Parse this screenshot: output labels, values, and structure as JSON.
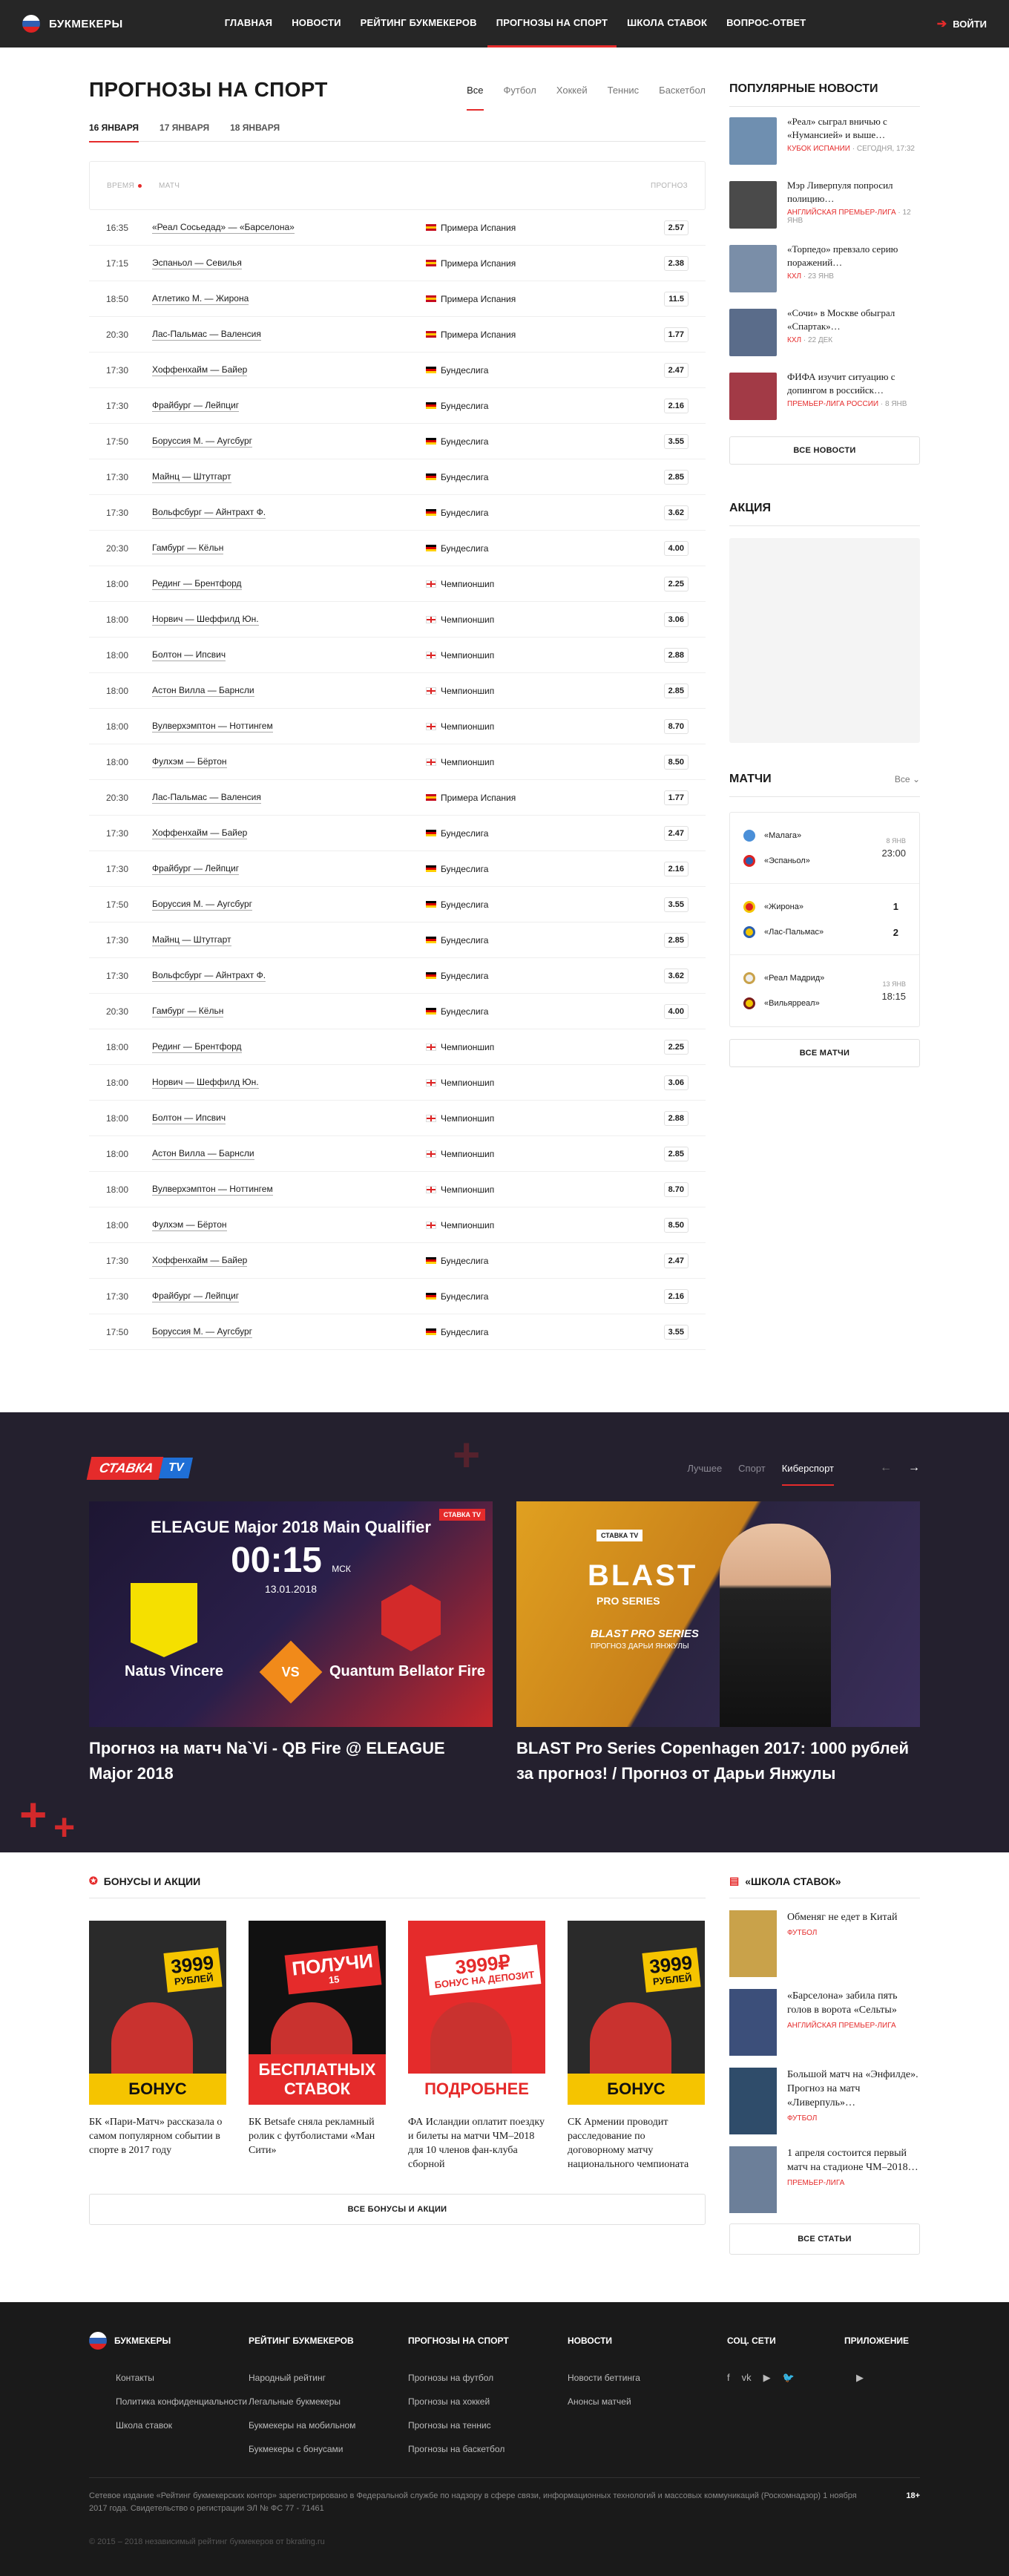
{
  "header": {
    "logo": "БУКМЕКЕРЫ",
    "nav": [
      "ГЛАВНАЯ",
      "НОВОСТИ",
      "РЕЙТИНГ БУКМЕКЕРОВ",
      "ПРОГНОЗЫ НА СПОРТ",
      "ШКОЛА СТАВОК",
      "ВОПРОС-ОТВЕТ"
    ],
    "login": "ВОЙТИ"
  },
  "page": {
    "title": "ПРОГНОЗЫ НА СПОРТ",
    "sport_tabs": [
      "Все",
      "Футбол",
      "Хоккей",
      "Теннис",
      "Баскетбол"
    ],
    "date_tabs": [
      "16 ЯНВАРЯ",
      "17 ЯНВАРЯ",
      "18 ЯНВАРЯ"
    ],
    "col_time": "ВРЕМЯ",
    "col_match": "МАТЧ",
    "col_forecast": "ПРОГНОЗ"
  },
  "matches": [
    {
      "time": "16:35",
      "match": "«Реал Сосьедад» — «Барселона»",
      "league": "Примера Испания",
      "flag": "es",
      "odd": "2.57"
    },
    {
      "time": "17:15",
      "match": "Эспаньол — Севилья",
      "league": "Примера Испания",
      "flag": "es",
      "odd": "2.38"
    },
    {
      "time": "18:50",
      "match": "Атлетико М. — Жирона",
      "league": "Примера Испания",
      "flag": "es",
      "odd": "11.5"
    },
    {
      "time": "20:30",
      "match": "Лас-Пальмас — Валенсия",
      "league": "Примера Испания",
      "flag": "es",
      "odd": "1.77"
    },
    {
      "time": "17:30",
      "match": "Хоффенхайм — Байер",
      "league": "Бундеслига",
      "flag": "de",
      "odd": "2.47"
    },
    {
      "time": "17:30",
      "match": "Фрайбург — Лейпциг",
      "league": "Бундеслига",
      "flag": "de",
      "odd": "2.16"
    },
    {
      "time": "17:50",
      "match": "Боруссия М. — Аугсбург",
      "league": "Бундеслига",
      "flag": "de",
      "odd": "3.55"
    },
    {
      "time": "17:30",
      "match": "Майнц — Штутгарт",
      "league": "Бундеслига",
      "flag": "de",
      "odd": "2.85"
    },
    {
      "time": "17:30",
      "match": "Вольфсбург — Айнтрахт Ф.",
      "league": "Бундеслига",
      "flag": "de",
      "odd": "3.62"
    },
    {
      "time": "20:30",
      "match": "Гамбург — Кёльн",
      "league": "Бундеслига",
      "flag": "de",
      "odd": "4.00"
    },
    {
      "time": "18:00",
      "match": "Рединг — Брентфорд",
      "league": "Чемпионшип",
      "flag": "en",
      "odd": "2.25"
    },
    {
      "time": "18:00",
      "match": "Норвич — Шеффилд Юн.",
      "league": "Чемпионшип",
      "flag": "en",
      "odd": "3.06"
    },
    {
      "time": "18:00",
      "match": "Болтон — Ипсвич",
      "league": "Чемпионшип",
      "flag": "en",
      "odd": "2.88"
    },
    {
      "time": "18:00",
      "match": "Астон Вилла — Барнсли",
      "league": "Чемпионшип",
      "flag": "en",
      "odd": "2.85"
    },
    {
      "time": "18:00",
      "match": "Вулверхэмптон — Ноттингем",
      "league": "Чемпионшип",
      "flag": "en",
      "odd": "8.70"
    },
    {
      "time": "18:00",
      "match": "Фулхэм — Бёртон",
      "league": "Чемпионшип",
      "flag": "en",
      "odd": "8.50"
    },
    {
      "time": "20:30",
      "match": "Лас-Пальмас — Валенсия",
      "league": "Примера Испания",
      "flag": "es",
      "odd": "1.77"
    },
    {
      "time": "17:30",
      "match": "Хоффенхайм — Байер",
      "league": "Бундеслига",
      "flag": "de",
      "odd": "2.47"
    },
    {
      "time": "17:30",
      "match": "Фрайбург — Лейпциг",
      "league": "Бундеслига",
      "flag": "de",
      "odd": "2.16"
    },
    {
      "time": "17:50",
      "match": "Боруссия М. — Аугсбург",
      "league": "Бундеслига",
      "flag": "de",
      "odd": "3.55"
    },
    {
      "time": "17:30",
      "match": "Майнц — Штутгарт",
      "league": "Бундеслига",
      "flag": "de",
      "odd": "2.85"
    },
    {
      "time": "17:30",
      "match": "Вольфсбург — Айнтрахт Ф.",
      "league": "Бундеслига",
      "flag": "de",
      "odd": "3.62"
    },
    {
      "time": "20:30",
      "match": "Гамбург — Кёльн",
      "league": "Бундеслига",
      "flag": "de",
      "odd": "4.00"
    },
    {
      "time": "18:00",
      "match": "Рединг — Брентфорд",
      "league": "Чемпионшип",
      "flag": "en",
      "odd": "2.25"
    },
    {
      "time": "18:00",
      "match": "Норвич — Шеффилд Юн.",
      "league": "Чемпионшип",
      "flag": "en",
      "odd": "3.06"
    },
    {
      "time": "18:00",
      "match": "Болтон — Ипсвич",
      "league": "Чемпионшип",
      "flag": "en",
      "odd": "2.88"
    },
    {
      "time": "18:00",
      "match": "Астон Вилла — Барнсли",
      "league": "Чемпионшип",
      "flag": "en",
      "odd": "2.85"
    },
    {
      "time": "18:00",
      "match": "Вулверхэмптон — Ноттингем",
      "league": "Чемпионшип",
      "flag": "en",
      "odd": "8.70"
    },
    {
      "time": "18:00",
      "match": "Фулхэм — Бёртон",
      "league": "Чемпионшип",
      "flag": "en",
      "odd": "8.50"
    },
    {
      "time": "17:30",
      "match": "Хоффенхайм — Байер",
      "league": "Бундеслига",
      "flag": "de",
      "odd": "2.47"
    },
    {
      "time": "17:30",
      "match": "Фрайбург — Лейпциг",
      "league": "Бундеслига",
      "flag": "de",
      "odd": "2.16"
    },
    {
      "time": "17:50",
      "match": "Боруссия М. — Аугсбург",
      "league": "Бундеслига",
      "flag": "de",
      "odd": "3.55"
    }
  ],
  "popular": {
    "title": "ПОПУЛЯРНЫЕ НОВОСТИ",
    "items": [
      {
        "title": "«Реал» сыграл вничью с «Нумансией» и выше…",
        "cat": "КУБОК ИСПАНИИ",
        "date": "СЕГОДНЯ, 17:32",
        "color": "#6f8fb0"
      },
      {
        "title": "Мэр Ливерпуля попросил полицию…",
        "cat": "АНГЛИЙСКАЯ ПРЕМЬЕР-ЛИГА",
        "date": "12 ЯНВ",
        "color": "#4a4a4a"
      },
      {
        "title": "«Торпедо» превзало серию поражений…",
        "cat": "КХЛ",
        "date": "23 ЯНВ",
        "color": "#7a8ea8"
      },
      {
        "title": "«Сочи» в Москве обыграл «Спартак»…",
        "cat": "КХЛ",
        "date": "22 ДЕК",
        "color": "#5a6c8a"
      },
      {
        "title": "ФИФА изучит ситуацию с допингом в российск…",
        "cat": "ПРЕМЬЕР-ЛИГА РОССИИ",
        "date": "8 ЯНВ",
        "color": "#a23a46"
      }
    ],
    "all": "ВСЕ НОВОСТИ"
  },
  "promo": {
    "title": "АКЦИЯ"
  },
  "side_matches": {
    "title": "МАТЧИ",
    "filter": "Все",
    "items": [
      {
        "home": "«Малага»",
        "away": "«Эспаньол»",
        "date": "8 ЯНВ",
        "time": "23:00"
      },
      {
        "home": "«Жирона»",
        "away": "«Лас-Пальмас»",
        "s1": "1",
        "s2": "2"
      },
      {
        "home": "«Реал Мадрид»",
        "away": "«Вильярреал»",
        "date": "13 ЯНВ",
        "time": "18:15"
      }
    ],
    "all": "ВСЕ МАТЧИ"
  },
  "tv": {
    "logo1": "СТАВКА",
    "logo2": "TV",
    "tabs": [
      "Лучшее",
      "Спорт",
      "Киберспорт"
    ],
    "arr_prev": "←",
    "arr_next": "→",
    "v1": {
      "event": "ELEAGUE Major 2018 Main Qualifier",
      "timer": "00:15",
      "tz": "МСК",
      "date": "13.01.2018",
      "t1": "Natus Vincere",
      "t2": "Quantum Bellator Fire",
      "vs": "VS",
      "tag": "СТАВКА TV",
      "caption": "Прогноз на матч Na`Vi - QB Fire @ ELEAGUE Major 2018"
    },
    "v2": {
      "tag": "СТАВКА TV",
      "brand": "BLAST",
      "sub": "PRO SERIES",
      "line1": "BLAST PRO SERIES",
      "line2": "ПРОГНОЗ ДАРЬИ ЯНЖУЛЫ",
      "caption": "BLAST Pro Series Copenhagen 2017: 1000 рублей за прогноз! / Прогноз от Дарьи Янжулы"
    }
  },
  "bonuses": {
    "title": "БОНУСЫ И АКЦИИ",
    "items": [
      {
        "badge1": "3999",
        "badge2": "РУБЛЕЙ",
        "badge3": "БОНУС",
        "text": "БК «Пари-Матч» рассказала о самом популярном событии в спорте в 2017 году"
      },
      {
        "badge1": "ПОЛУЧИ",
        "badge2": "15",
        "badge3": "БЕСПЛАТНЫХ СТАВОК",
        "text": "БК Betsafe сняла рекламный ролик с футболистами «Ман Сити»"
      },
      {
        "badge1": "3999₽",
        "badge2": "БОНУС НА ДЕПОЗИТ",
        "badge3": "ПОДРОБНЕЕ",
        "text": "ФА Исландии оплатит поездку и билеты на матчи ЧМ–2018 для 10 членов фан-клуба сборной"
      },
      {
        "badge1": "3999",
        "badge2": "РУБЛЕЙ",
        "badge3": "БОНУС",
        "text": "СК Армении проводит расследование по договорному матчу национального чемпионата"
      }
    ],
    "all": "ВСЕ БОНУСЫ И АКЦИИ"
  },
  "school": {
    "title": "«ШКОЛА СТАВОК»",
    "items": [
      {
        "title": "Обменяг не едет в Китай",
        "cat": "ФУТБОЛ",
        "color": "#c9a24a"
      },
      {
        "title": "«Барселона» забила пять голов в ворота «Сельты»",
        "cat": "АНГЛИЙСКАЯ ПРЕМЬЕР-ЛИГА",
        "color": "#3c4f7a"
      },
      {
        "title": "Большой матч на «Энфилде». Прогноз на матч «Ливерпуль»…",
        "cat": "ФУТБОЛ",
        "color": "#2f4c6a"
      },
      {
        "title": "1 апреля состоится первый матч на стадионе ЧМ–2018…",
        "cat": "ПРЕМЬЕР-ЛИГА",
        "color": "#6c7f99"
      }
    ],
    "all": "ВСЕ СТАТЬИ"
  },
  "footer": {
    "logo": "БУКМЕКЕРЫ",
    "col1": [
      "Контакты",
      "Политика конфиденциальности",
      "Школа ставок"
    ],
    "h2": "РЕЙТИНГ БУКМЕКЕРОВ",
    "col2": [
      "Народный рейтинг",
      "Легальные букмекеры",
      "Букмекеры на мобильном",
      "Букмекеры с бонусами"
    ],
    "h3": "ПРОГНОЗЫ НА СПОРТ",
    "col3": [
      "Прогнозы на футбол",
      "Прогнозы на хоккей",
      "Прогнозы на теннис",
      "Прогнозы на баскетбол"
    ],
    "h4": "НОВОСТИ",
    "col4": [
      "Новости беттинга",
      "Анонсы матчей"
    ],
    "h5": "СОЦ. СЕТИ",
    "social": [
      "f",
      "vk",
      "▶",
      "🐦"
    ],
    "h6": "ПРИЛОЖЕНИЕ",
    "app": [
      "",
      "▶"
    ],
    "legal": "Сетевое издание «Рейтинг букмекерских контор» зарегистрировано в Федеральной службе по надзору в сфере связи, информационных технологий и массовых коммуникаций (Роскомнадзор) 1 ноября 2017 года. Свидетельство о регистрации ЭЛ № ФС 77 - 71461",
    "age": "18+",
    "copy": "© 2015 – 2018 независимый рейтинг букмекеров от bkrating.ru"
  }
}
